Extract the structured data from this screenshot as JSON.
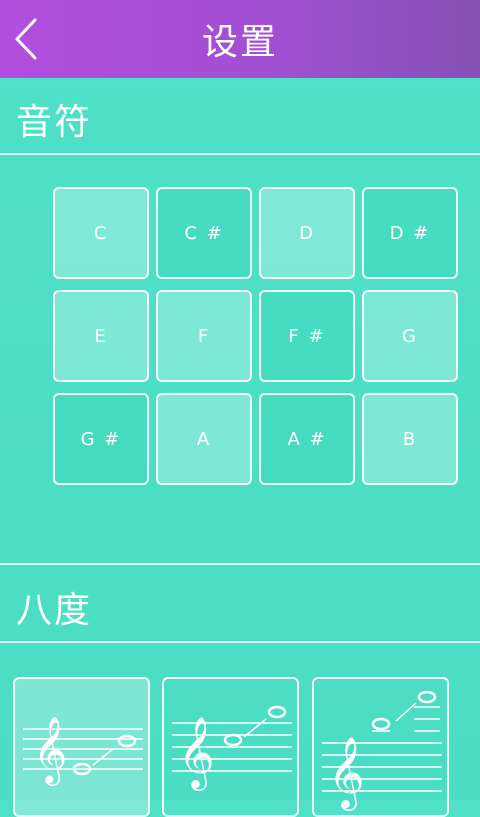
{
  "header": {
    "title": "设置",
    "back_icon": "chevron-left-icon"
  },
  "notes_section": {
    "label": "音符",
    "notes": [
      {
        "label": "C",
        "selected": true
      },
      {
        "label": "C #",
        "selected": false
      },
      {
        "label": "D",
        "selected": true
      },
      {
        "label": "D #",
        "selected": false
      },
      {
        "label": "E",
        "selected": true
      },
      {
        "label": "F",
        "selected": true
      },
      {
        "label": "F #",
        "selected": false
      },
      {
        "label": "G",
        "selected": true
      },
      {
        "label": "G #",
        "selected": false
      },
      {
        "label": "A",
        "selected": true
      },
      {
        "label": "A #",
        "selected": false
      },
      {
        "label": "B",
        "selected": true
      }
    ]
  },
  "octave_section": {
    "label": "八度",
    "options": [
      {
        "name": "low-octave",
        "selected": true,
        "icon": "treble-clef-staff-icon"
      },
      {
        "name": "middle-octave",
        "selected": false,
        "icon": "treble-clef-staff-icon"
      },
      {
        "name": "high-octave",
        "selected": false,
        "icon": "treble-clef-staff-icon"
      }
    ]
  }
}
